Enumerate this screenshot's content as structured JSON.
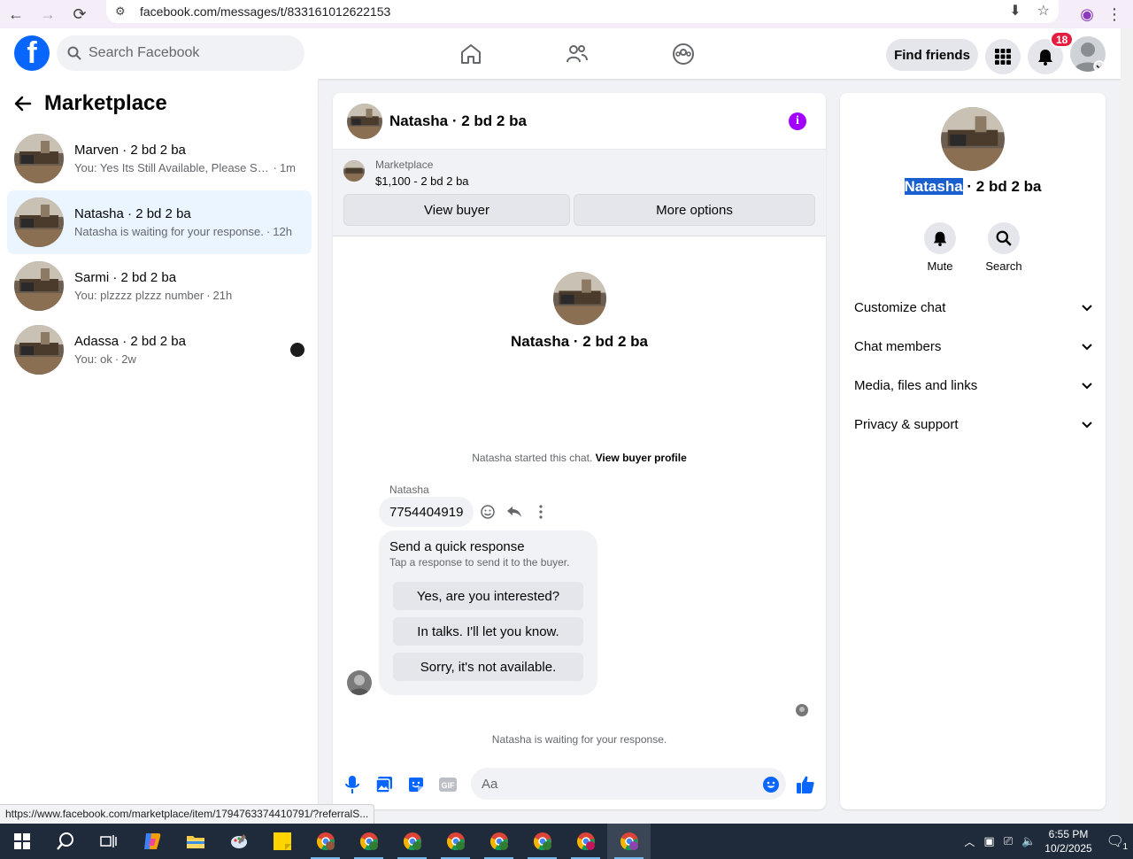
{
  "browser": {
    "url": "facebook.com/messages/t/833161012622153",
    "status_url": "https://www.facebook.com/marketplace/item/1794763374410791/?referralS..."
  },
  "topnav": {
    "search_placeholder": "Search Facebook",
    "find_friends": "Find friends",
    "notification_count": "18"
  },
  "left": {
    "title": "Marketplace",
    "conversations": [
      {
        "name": "Marven · 2 bd 2 ba",
        "preview": "You: Yes Its Still Available, Please Sen...",
        "time": "1m",
        "active": false
      },
      {
        "name": "Natasha · 2 bd 2 ba",
        "preview": "Natasha is waiting for your response.",
        "time": "12h",
        "active": true
      },
      {
        "name": "Sarmi · 2 bd 2 ba",
        "preview": "You: plzzzz plzzz number",
        "time": "21h",
        "active": false
      },
      {
        "name": "Adassa · 2 bd 2 ba",
        "preview": "You: ok",
        "time": "2w",
        "active": false
      }
    ]
  },
  "chat": {
    "title": "Natasha · 2 bd 2 ba",
    "listing_label": "Marketplace",
    "listing_price": "$1,100 - 2 bd 2 ba",
    "view_buyer": "View buyer",
    "more_options": "More options",
    "intro_name": "Natasha · 2 bd 2 ba",
    "started_text": "Natasha started this chat.",
    "view_buyer_profile": "View buyer profile",
    "sender": "Natasha",
    "message": "7754404919",
    "quick_title": "Send a quick response",
    "quick_sub": "Tap a response to send it to the buyer.",
    "quick_options": [
      "Yes, are you interested?",
      "In talks. I'll let you know.",
      "Sorry, it's not available."
    ],
    "waiting": "Natasha is waiting for your response.",
    "input_placeholder": "Aa"
  },
  "right": {
    "name_highlight": "Natasha",
    "name_rest": " · 2 bd 2 ba",
    "mute": "Mute",
    "search": "Search",
    "sections": [
      "Customize chat",
      "Chat members",
      "Media, files and links",
      "Privacy & support"
    ]
  },
  "taskbar": {
    "time": "6:55 PM",
    "date": "10/2/2025",
    "notif_count": "1"
  },
  "colors": {
    "fb_blue": "#0866ff",
    "active_conv": "#ebf5ff",
    "badge_red": "#e41e3f",
    "info_purple": "#a100ff"
  }
}
